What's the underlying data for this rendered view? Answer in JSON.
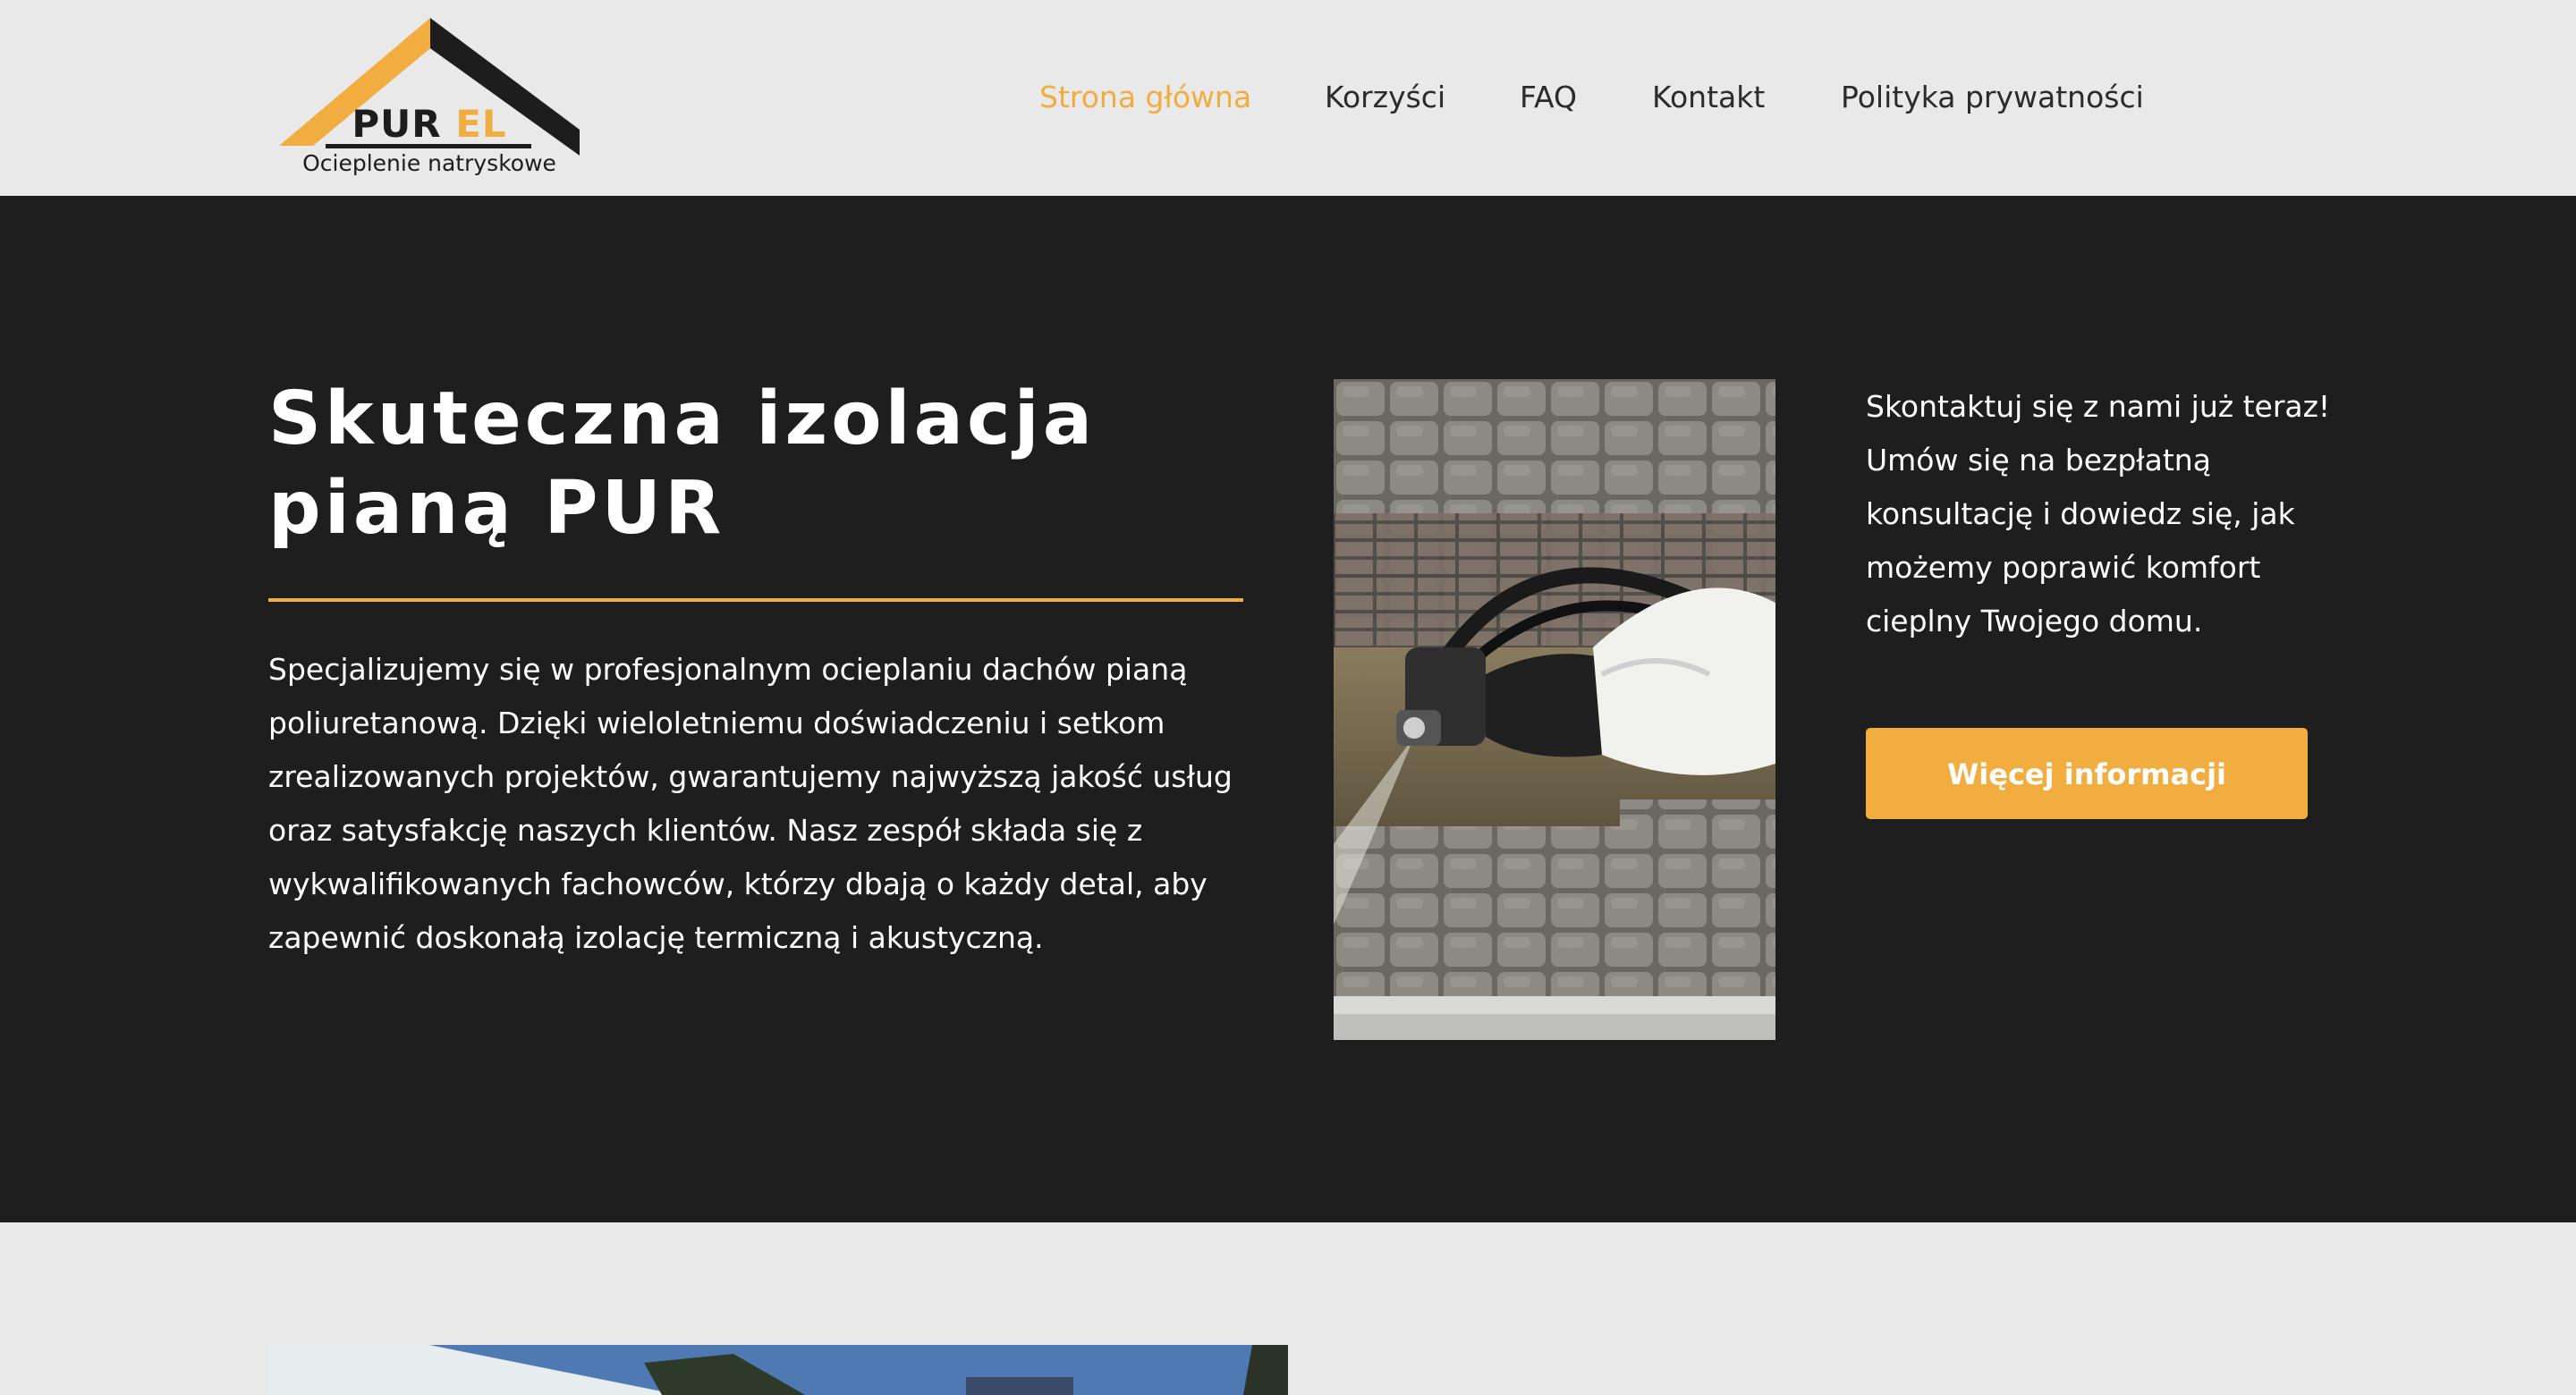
{
  "header": {
    "logo": {
      "brand_part1": "PUR",
      "brand_part2": "EL",
      "tagline": "Ocieplenie natryskowe"
    },
    "nav": [
      {
        "label": "Strona główna",
        "active": true
      },
      {
        "label": "Korzyści",
        "active": false
      },
      {
        "label": "FAQ",
        "active": false
      },
      {
        "label": "Kontakt",
        "active": false
      },
      {
        "label": "Polityka prywatności",
        "active": false
      }
    ]
  },
  "hero": {
    "title": "Skuteczna izolacja pianą PUR",
    "description": "Specjalizujemy się w profesjonalnym ocieplaniu dachów pianą poliuretanową. Dzięki wieloletniemu doświadczeniu i setkom zrealizowanych projektów, gwarantujemy najwyższą jakość usług oraz satysfakcję naszych klientów. Nasz zespół składa się z wykwalifikowanych fachowców, którzy dbają o każdy detal, aby zapewnić doskonałą izolację termiczną i akustyczną.",
    "contact_text": "Skontaktuj się z nami już teraz! Umów się na bezpłatną konsultację i dowiedz się, jak możemy poprawić komfort cieplny Twojego domu.",
    "cta_label": "Więcej informacji"
  },
  "colors": {
    "accent": "#f2ad40",
    "hero_background": "#1f1e1e",
    "header_background": "#e9e9e9",
    "nav_text": "#2b2b2b"
  }
}
